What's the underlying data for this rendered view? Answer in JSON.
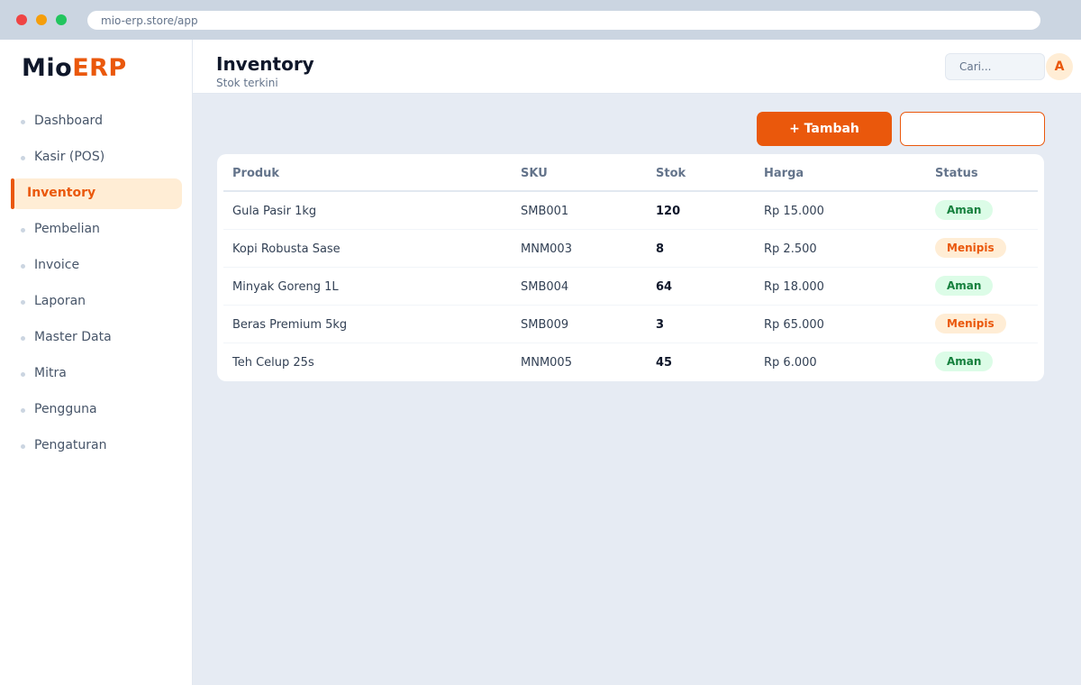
{
  "browser": {
    "url": "mio-erp.store/app"
  },
  "brand": {
    "part1": "Mio",
    "part2": "ERP"
  },
  "sidebar": {
    "items": [
      {
        "label": "Dashboard",
        "active": false
      },
      {
        "label": "Kasir (POS)",
        "active": false
      },
      {
        "label": "Inventory",
        "active": true
      },
      {
        "label": "Pembelian",
        "active": false
      },
      {
        "label": "Invoice",
        "active": false
      },
      {
        "label": "Laporan",
        "active": false
      },
      {
        "label": "Master Data",
        "active": false
      },
      {
        "label": "Mitra",
        "active": false
      },
      {
        "label": "Pengguna",
        "active": false
      },
      {
        "label": "Pengaturan",
        "active": false
      }
    ]
  },
  "header": {
    "title": "Inventory",
    "subtitle": "Stok terkini",
    "search_placeholder": "Cari...",
    "avatar_initial": "A"
  },
  "toolbar": {
    "add_label": "+ Tambah",
    "secondary_label": ""
  },
  "table": {
    "columns": [
      "Produk",
      "SKU",
      "Stok",
      "Harga",
      "Status"
    ],
    "rows": [
      {
        "produk": "Gula Pasir 1kg",
        "sku": "SMB001",
        "stok": "120",
        "harga": "Rp 15.000",
        "status": "Aman",
        "status_type": "ok"
      },
      {
        "produk": "Kopi Robusta Sase",
        "sku": "MNM003",
        "stok": "8",
        "harga": "Rp 2.500",
        "status": "Menipis",
        "status_type": "warn"
      },
      {
        "produk": "Minyak Goreng 1L",
        "sku": "SMB004",
        "stok": "64",
        "harga": "Rp 18.000",
        "status": "Aman",
        "status_type": "ok"
      },
      {
        "produk": "Beras Premium 5kg",
        "sku": "SMB009",
        "stok": "3",
        "harga": "Rp 65.000",
        "status": "Menipis",
        "status_type": "warn"
      },
      {
        "produk": "Teh Celup 25s",
        "sku": "MNM005",
        "stok": "45",
        "harga": "Rp 6.000",
        "status": "Aman",
        "status_type": "ok"
      }
    ]
  },
  "colors": {
    "accent": "#ea580c",
    "accent_soft": "#ffedd5",
    "ok_bg": "#dcfce7",
    "ok_text": "#15803d",
    "content_bg": "#e6ebf3"
  }
}
